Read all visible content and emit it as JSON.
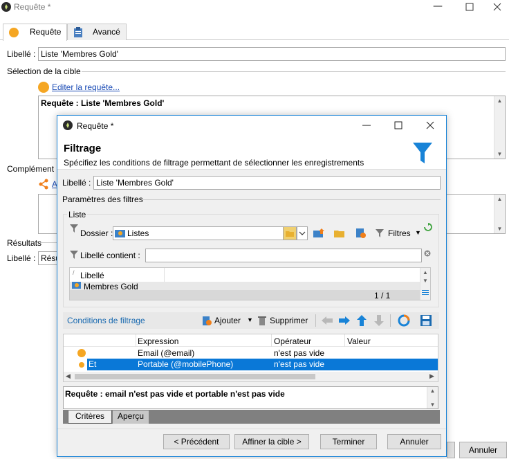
{
  "window": {
    "title": "Requête *",
    "tabs": [
      {
        "label": "Requête"
      },
      {
        "label": "Avancé"
      }
    ],
    "libelle_label": "Libellé :",
    "libelle_value": "Liste 'Membres Gold'",
    "target_section": "Sélection de la cible",
    "edit_link": "Editer la requête...",
    "query_text": "Requête : Liste 'Membres Gold'",
    "complement_section": "Complément",
    "complement_link_fragment": "A",
    "results_section": "Résultats",
    "results_libelle_label": "Libellé :",
    "results_libelle_value": "Résu",
    "cancel_label": "Annuler"
  },
  "dialog": {
    "title": "Requête *",
    "heading": "Filtrage",
    "subheading": "Spécifiez les conditions de filtrage permettant de sélectionner les enregistrements",
    "libelle_label": "Libellé :",
    "libelle_value": "Liste 'Membres Gold'",
    "params_section": "Paramètres des filtres",
    "list_group": "Liste",
    "dossier_label": "Dossier :",
    "dossier_value": "Listes",
    "filters_label": "Filtres",
    "libelle_contient_label": "Libellé contient :",
    "libelle_contient_value": "",
    "list_column": "Libellé",
    "list_items": [
      "Membres Gold"
    ],
    "list_pager": "1 / 1",
    "conditions_title": "Conditions de filtrage",
    "add_label": "Ajouter",
    "delete_label": "Supprimer",
    "grid_headers": [
      "Expression",
      "Opérateur",
      "Valeur"
    ],
    "grid_rows": [
      {
        "prefix": "",
        "expression": "Email (@email)",
        "operator": "n'est pas vide",
        "value": ""
      },
      {
        "prefix": "Et",
        "expression": "Portable (@mobilePhone)",
        "operator": "n'est pas vide",
        "value": ""
      }
    ],
    "query_summary": "Requête : email n'est pas vide et portable n'est pas vide",
    "bottom_tabs": [
      {
        "label": "Critères"
      },
      {
        "label": "Aperçu"
      }
    ],
    "buttons": {
      "previous": "< Précédent",
      "refine": "Affiner la cible >",
      "finish": "Terminer",
      "cancel": "Annuler"
    }
  },
  "colors": {
    "accent": "#1883d7",
    "orange": "#f5a623",
    "selection": "#0a78d7"
  }
}
